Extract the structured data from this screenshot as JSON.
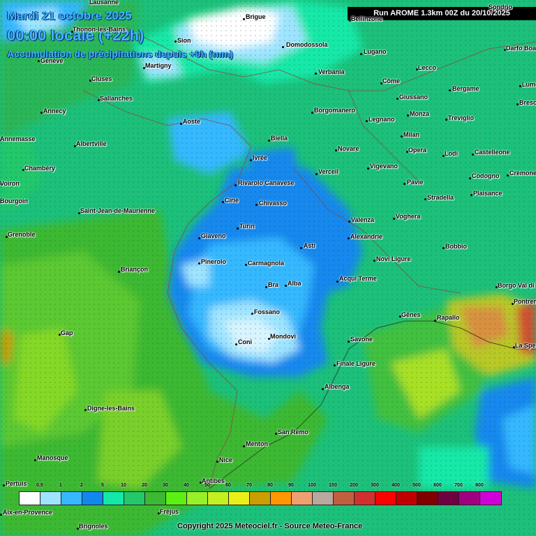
{
  "header": {
    "date": "Mardi 21 octobre 2025",
    "time": "00:00 locale (+22h)",
    "title": "Accumulation de précipitations depuis +0h (mm)",
    "run": "Run AROME 1.3km 00Z du 20/10/2025"
  },
  "cities": [
    {
      "name": "Lausanne"
    },
    {
      "name": "Brigue"
    },
    {
      "name": "Thonon-les-Bains"
    },
    {
      "name": "Sion"
    },
    {
      "name": "Domodossola"
    },
    {
      "name": "Lugano"
    },
    {
      "name": "Darfo Boario"
    },
    {
      "name": "Genève"
    },
    {
      "name": "Martigny"
    },
    {
      "name": "Verbania"
    },
    {
      "name": "Lecco"
    },
    {
      "name": "Cluses"
    },
    {
      "name": "Côme"
    },
    {
      "name": "Bergame"
    },
    {
      "name": "Lumezzane"
    },
    {
      "name": "Sallanches"
    },
    {
      "name": "Giussano"
    },
    {
      "name": "Annecy"
    },
    {
      "name": "Borgomanero"
    },
    {
      "name": "Monza"
    },
    {
      "name": "Brescia"
    },
    {
      "name": "Aoste"
    },
    {
      "name": "Legnano"
    },
    {
      "name": "Treviglio"
    },
    {
      "name": "Milan"
    },
    {
      "name": "Annemasse"
    },
    {
      "name": "Albertville"
    },
    {
      "name": "Biella"
    },
    {
      "name": "Novare"
    },
    {
      "name": "Opera"
    },
    {
      "name": "Lodi"
    },
    {
      "name": "Castelleone"
    },
    {
      "name": "Ivrée"
    },
    {
      "name": "Chambéry"
    },
    {
      "name": "Verceil"
    },
    {
      "name": "Vigevano"
    },
    {
      "name": "Codogno"
    },
    {
      "name": "Crémone"
    },
    {
      "name": "Rivarolo Canavese"
    },
    {
      "name": "Pavie"
    },
    {
      "name": "Plaisance"
    },
    {
      "name": "Ciriè"
    },
    {
      "name": "Chivasso"
    },
    {
      "name": "Stradella"
    },
    {
      "name": "Saint-Jean-de-Maurienne"
    },
    {
      "name": "Voghera"
    },
    {
      "name": "Valenza"
    },
    {
      "name": "Turin"
    },
    {
      "name": "Grenoble"
    },
    {
      "name": "Giaveno"
    },
    {
      "name": "Alexandrie"
    },
    {
      "name": "Asti"
    },
    {
      "name": "Bobbio"
    },
    {
      "name": "Novi Ligure"
    },
    {
      "name": "Pinerolo"
    },
    {
      "name": "Carmagnola"
    },
    {
      "name": "Briançon"
    },
    {
      "name": "Acqui Terme"
    },
    {
      "name": "Bra"
    },
    {
      "name": "Alba"
    },
    {
      "name": "Borgo Val di Taro"
    },
    {
      "name": "Pontremoli"
    },
    {
      "name": "Fossano"
    },
    {
      "name": "Gênes"
    },
    {
      "name": "Rapallo"
    },
    {
      "name": "Gap"
    },
    {
      "name": "Coni"
    },
    {
      "name": "Mondovì"
    },
    {
      "name": "Savone"
    },
    {
      "name": "La Spezia"
    },
    {
      "name": "Finale Ligure"
    },
    {
      "name": "Albenga"
    },
    {
      "name": "Digne-les-Bains"
    },
    {
      "name": "San Remo"
    },
    {
      "name": "Menton"
    },
    {
      "name": "Manosque"
    },
    {
      "name": "Nice"
    },
    {
      "name": "Antibes"
    },
    {
      "name": "Pertuis"
    },
    {
      "name": "Aix-en-Provence"
    },
    {
      "name": "Fréjus"
    },
    {
      "name": "Brignoles"
    },
    {
      "name": "Sondrio"
    },
    {
      "name": "Bellinzone"
    },
    {
      "name": "Voiron"
    },
    {
      "name": "Bourgoin"
    }
  ],
  "legend": {
    "labels": [
      "0.5",
      "1",
      "2",
      "5",
      "10",
      "20",
      "30",
      "40",
      "50",
      "60",
      "70",
      "80",
      "90",
      "100",
      "150",
      "200",
      "300",
      "400",
      "500",
      "600",
      "700",
      "800"
    ],
    "colors": [
      "#ffffff",
      "#9fe4ff",
      "#36b8ff",
      "#1288ee",
      "#13e8a8",
      "#22c86a",
      "#3cb832",
      "#5cf012",
      "#98f028",
      "#c4f020",
      "#e8f018",
      "#c89e00",
      "#ff9800",
      "#f0a070",
      "#b8a8a0",
      "#c06040",
      "#d03030",
      "#ff0000",
      "#c00000",
      "#800000",
      "#700040",
      "#a00080",
      "#d000d8"
    ]
  },
  "copyright": "Copyright 2025 Meteociel.fr - Source Meteo-France"
}
